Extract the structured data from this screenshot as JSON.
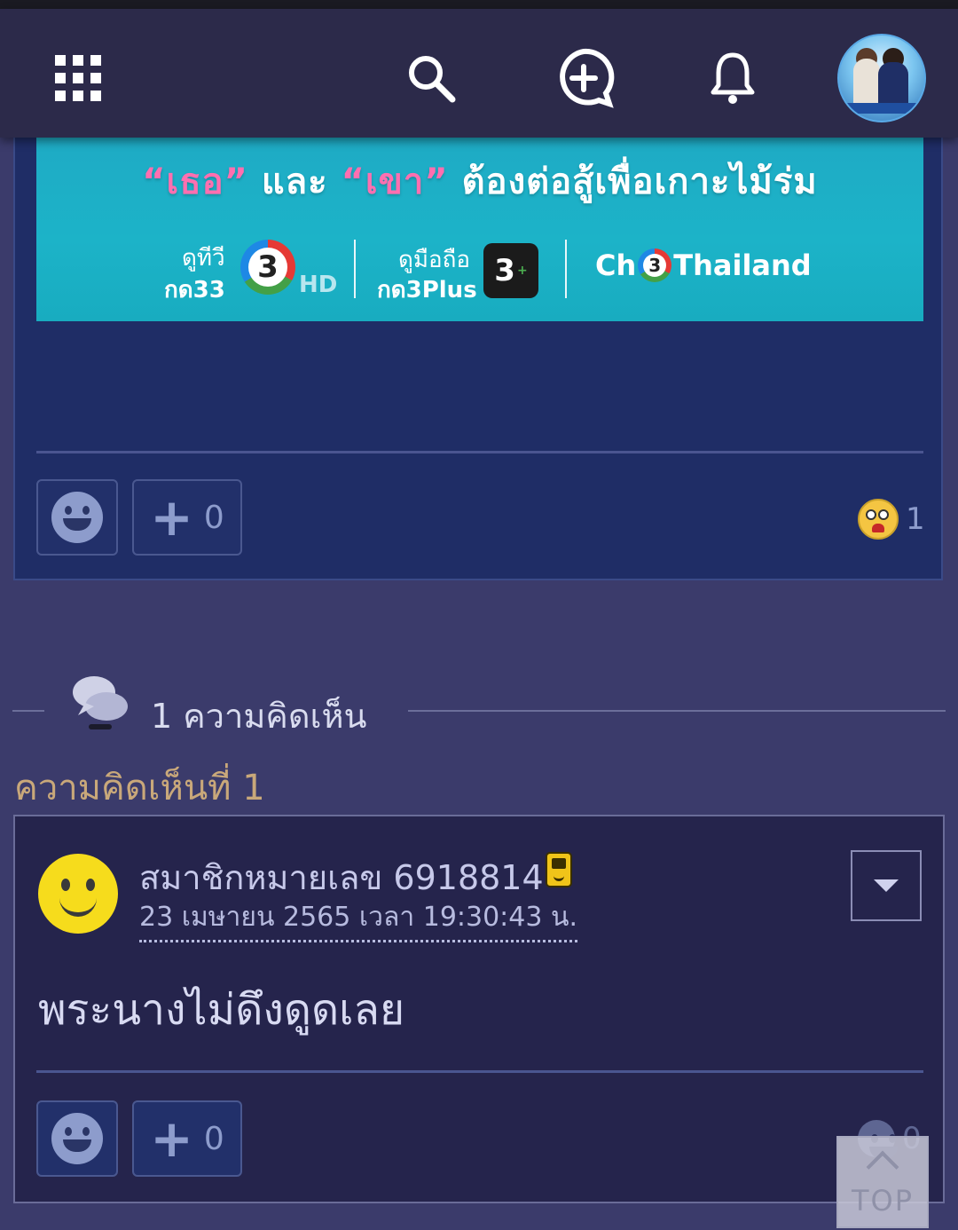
{
  "nav": {
    "icons": [
      "grid-menu-icon",
      "search-icon",
      "new-post-icon",
      "bell-icon"
    ],
    "avatar_alt": "profile-avatar"
  },
  "post": {
    "banner": {
      "headline_parts": [
        "“เธอ”",
        " และ ",
        "“เขา”",
        " ต้องต่อสู้เพื่อเกาะไม้ร่ม"
      ],
      "tv_label_top": "ดูทีวี",
      "tv_label_bottom": "กด33",
      "tv_hd": "HD",
      "mobile_label_top": "ดูมือถือ",
      "mobile_label_bottom": "กด3Plus",
      "channel_prefix": "Ch",
      "channel_suffix": "Thailand",
      "logo_digit": "3"
    },
    "plus_count": "0",
    "reaction_count": "1"
  },
  "comments_header": {
    "count_text": "1 ความคิดเห็น",
    "comment_number_label": "ความคิดเห็นที่ 1"
  },
  "comment": {
    "username": "สมาชิกหมายเลข 6918814",
    "timestamp": "23 เมษายน 2565 เวลา 19:30:43 น.",
    "text": "พระนางไม่ดึงดูดเลย",
    "plus_count": "0",
    "reaction_count": "0"
  },
  "top_button": {
    "label": "TOP"
  },
  "colors": {
    "navbar": "#2c2a4a",
    "post_card": "#1f2d66",
    "page_bg": "#3b3b6b",
    "comment_label": "#c9a87a",
    "banner": "#1cb3c8"
  }
}
